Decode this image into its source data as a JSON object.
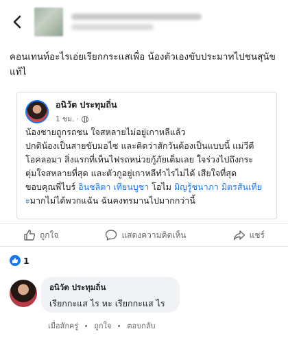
{
  "post": {
    "caption": "คอนเทนท์อะไรเอ่ยเรียกกระแสเพื่อ น้องตัวเองขับประมาทไปชนสุนัขแท้ไ"
  },
  "shared": {
    "author": "อนิวัต ประทุมถิ่น",
    "time": "1 ชม. ·",
    "line1": "น้องชายถูกรถชน ใจสหลายไม่อยู่เกาหลีแล้ว",
    "line2": "ปกติน้องเป็นสายขับมอไซ และคิดว่าสักวันต้องเป็นแบบนี้ แม่วีดี",
    "line3": "โอคลอมา สิ่งแรกที่เห็นไฟรถหน่วยกู้ภัยเต็มเลย ใจร่วงไปถึงกระ",
    "line4": "ตุ่มใจสหลายที่สุด และตัวกูอยู่เกาหลีทำไรไม่ได้ เสียใจที่สุด",
    "line5_pre": "ขอบคุณพี่ไบร์ ",
    "line5_link1": "อินชลิตา เทียนบูชา",
    "line5_mid": "โอไม ",
    "line5_link2": "มิญรู้ชนาภา มิตรสันเทีย",
    "line6_link": "ะ",
    "line6_rest": "มากไม่ได้พวกแฉัน ฉันคงทรมานไปมากกว่านี้"
  },
  "actions": {
    "like": "ถูกใจ",
    "comment": "แสดงความคิดเห็น",
    "share": "แชร์"
  },
  "reactions": {
    "count": "1"
  },
  "comment": {
    "author": "อนิวัต ประทุมถิ่น",
    "text": "เรียกกะแส ไร หะ เรียกกะแส ไร",
    "time": "เมื่อสักครู่",
    "like": "ถูกใจ",
    "reply": "ตอบกลับ"
  },
  "icons": {
    "back": "chevron-left-icon",
    "like": "thumbs-up-icon",
    "comment": "speech-bubble-icon",
    "share": "share-arrow-icon",
    "globe": "globe-icon"
  },
  "colors": {
    "accent": "#1877f2",
    "muted": "#65676b",
    "bubble": "#f0f2f5"
  }
}
